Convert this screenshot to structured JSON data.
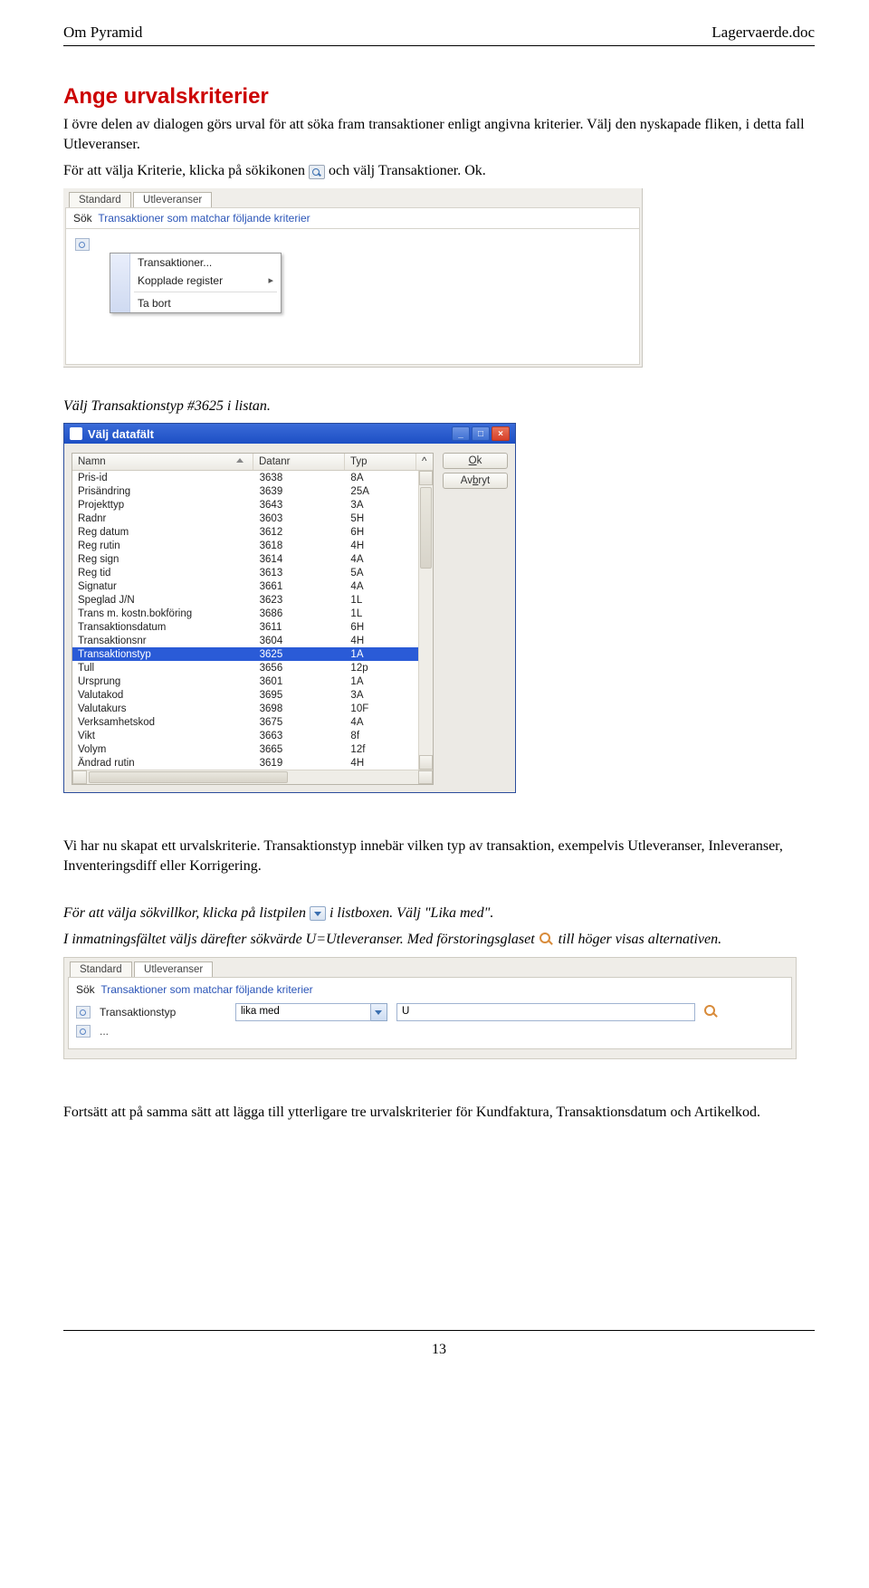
{
  "header": {
    "left": "Om Pyramid",
    "right": "Lagervaerde.doc"
  },
  "section_title": "Ange urvalskriterier",
  "para1": "I övre delen av dialogen görs urval för att söka fram transaktioner enligt angivna kriterier. Välj den nyskapade fliken, i detta fall Utleveranser.",
  "para2a": "För att välja Kriterie, klicka på sökikonen ",
  "para2b": " och välj Transaktioner. Ok.",
  "caption1": "Välj Transaktionstyp #3625 i listan.",
  "para3": "Vi har nu skapat ett urvalskriterie. Transaktionstyp innebär vilken typ av transaktion, exempelvis Utleveranser, Inleveranser, Inventeringsdiff eller Korrigering.",
  "cap2a": "För att välja sökvillkor, klicka på listpilen ",
  "cap2b": " i listboxen. Välj \"Lika med\".",
  "cap3a": "I inmatningsfältet väljs därefter sökvärde U=Utleveranser. Med förstoringsglaset ",
  "cap3b": " till höger visas alternativen.",
  "para4": "Fortsätt att på samma sätt att lägga till ytterligare tre urvalskriterier för Kundfaktura, Transaktionsdatum och Artikelkod.",
  "page_number": "13",
  "shot1": {
    "tabs": [
      "Standard",
      "Utleveranser"
    ],
    "barLabel": "Sök",
    "barText": "Transaktioner som matchar följande kriterier",
    "menu": {
      "item1": "Transaktioner...",
      "item2": "Kopplade register",
      "item3": "Ta bort"
    }
  },
  "shot2": {
    "title": "Välj datafält",
    "headers": {
      "name": "Namn",
      "nr": "Datanr",
      "typ": "Typ"
    },
    "buttons": {
      "ok": "Ok",
      "cancel": "Avbryt"
    },
    "rows": [
      {
        "name": "Pris-id",
        "nr": "3638",
        "typ": "8A",
        "sel": false
      },
      {
        "name": "Prisändring",
        "nr": "3639",
        "typ": "25A",
        "sel": false
      },
      {
        "name": "Projekttyp",
        "nr": "3643",
        "typ": "3A",
        "sel": false
      },
      {
        "name": "Radnr",
        "nr": "3603",
        "typ": "5H",
        "sel": false
      },
      {
        "name": "Reg datum",
        "nr": "3612",
        "typ": "6H",
        "sel": false
      },
      {
        "name": "Reg rutin",
        "nr": "3618",
        "typ": "4H",
        "sel": false
      },
      {
        "name": "Reg sign",
        "nr": "3614",
        "typ": "4A",
        "sel": false
      },
      {
        "name": "Reg tid",
        "nr": "3613",
        "typ": "5A",
        "sel": false
      },
      {
        "name": "Signatur",
        "nr": "3661",
        "typ": "4A",
        "sel": false
      },
      {
        "name": "Speglad J/N",
        "nr": "3623",
        "typ": "1L",
        "sel": false
      },
      {
        "name": "Trans m. kostn.bokföring",
        "nr": "3686",
        "typ": "1L",
        "sel": false
      },
      {
        "name": "Transaktionsdatum",
        "nr": "3611",
        "typ": "6H",
        "sel": false
      },
      {
        "name": "Transaktionsnr",
        "nr": "3604",
        "typ": "4H",
        "sel": false
      },
      {
        "name": "Transaktionstyp",
        "nr": "3625",
        "typ": "1A",
        "sel": true
      },
      {
        "name": "Tull",
        "nr": "3656",
        "typ": "12p",
        "sel": false
      },
      {
        "name": "Ursprung",
        "nr": "3601",
        "typ": "1A",
        "sel": false
      },
      {
        "name": "Valutakod",
        "nr": "3695",
        "typ": "3A",
        "sel": false
      },
      {
        "name": "Valutakurs",
        "nr": "3698",
        "typ": "10F",
        "sel": false
      },
      {
        "name": "Verksamhetskod",
        "nr": "3675",
        "typ": "4A",
        "sel": false
      },
      {
        "name": "Vikt",
        "nr": "3663",
        "typ": "8f",
        "sel": false
      },
      {
        "name": "Volym",
        "nr": "3665",
        "typ": "12f",
        "sel": false
      },
      {
        "name": "Ändrad rutin",
        "nr": "3619",
        "typ": "4H",
        "sel": false
      }
    ]
  },
  "shot3": {
    "tabs": [
      "Standard",
      "Utleveranser"
    ],
    "caption": "Transaktioner som matchar följande kriterier",
    "captionLabel": "Sök",
    "row": {
      "label": "Transaktionstyp",
      "op": "lika med",
      "value": "U"
    },
    "dots": "..."
  }
}
